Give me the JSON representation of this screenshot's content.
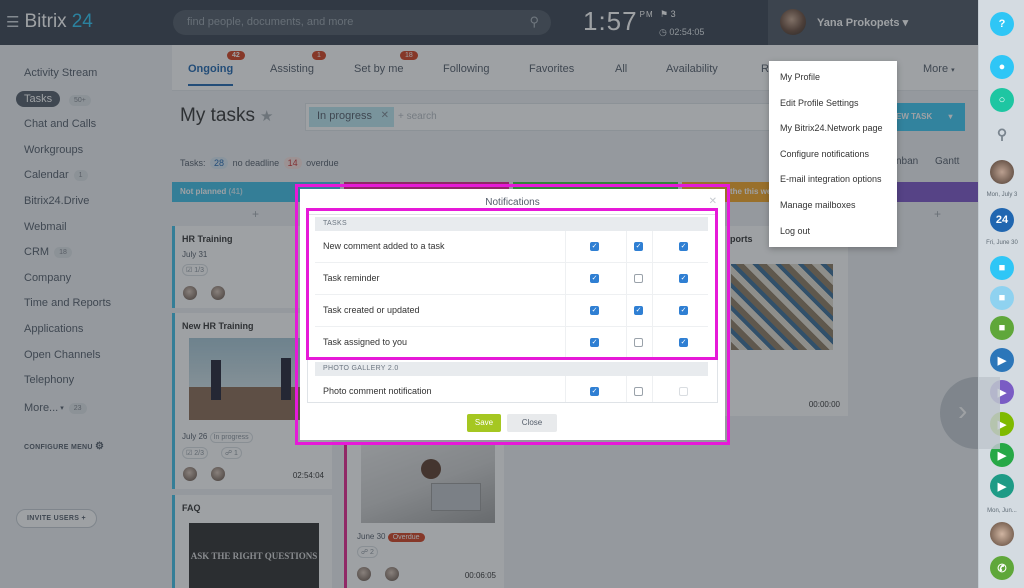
{
  "header": {
    "app_name": "Bitrix",
    "app_suffix": "24",
    "search_placeholder": "find people, documents, and more",
    "clock": "1:57",
    "clock_ampm": "PM",
    "flag_count": "3",
    "timer": "02:54:05",
    "user_name": "Yana Prokopets"
  },
  "left_nav": {
    "items": [
      {
        "label": "Activity Stream",
        "badge": ""
      },
      {
        "label": "Tasks",
        "badge": "50+"
      },
      {
        "label": "Chat and Calls",
        "badge": ""
      },
      {
        "label": "Workgroups",
        "badge": ""
      },
      {
        "label": "Calendar",
        "badge": "1"
      },
      {
        "label": "Bitrix24.Drive",
        "badge": ""
      },
      {
        "label": "Webmail",
        "badge": ""
      },
      {
        "label": "CRM",
        "badge": "18"
      },
      {
        "label": "Company",
        "badge": ""
      },
      {
        "label": "Time and Reports",
        "badge": ""
      },
      {
        "label": "Applications",
        "badge": ""
      },
      {
        "label": "Open Channels",
        "badge": ""
      },
      {
        "label": "Telephony",
        "badge": ""
      },
      {
        "label": "More...",
        "badge": "23"
      }
    ],
    "configure_menu": "CONFIGURE MENU",
    "invite_users": "INVITE USERS"
  },
  "tabs": [
    {
      "label": "Ongoing",
      "badge": "42"
    },
    {
      "label": "Assisting",
      "badge": "1"
    },
    {
      "label": "Set by me",
      "badge": "18"
    },
    {
      "label": "Following",
      "badge": ""
    },
    {
      "label": "Favorites",
      "badge": ""
    },
    {
      "label": "All",
      "badge": ""
    },
    {
      "label": "Availability",
      "badge": ""
    },
    {
      "label": "R",
      "badge": ""
    },
    {
      "label": "More",
      "badge": ""
    }
  ],
  "page": {
    "title": "My tasks",
    "filter_chip": "In progress",
    "filter_placeholder": "+ search",
    "new_task_label": "EW TASK",
    "counters_label": "Tasks:",
    "no_deadline_count": "28",
    "no_deadline_label": "no deadline",
    "overdue_count": "14",
    "overdue_label": "overdue",
    "view_kanban": "nban",
    "view_gantt": "Gantt"
  },
  "kanban": {
    "col1_title": "Not planned",
    "col1_count": "(41)",
    "col4_title": "the this we",
    "cards": [
      {
        "title": "HR Training",
        "date": "July 31",
        "pill": "1/3",
        "time": "0"
      },
      {
        "title": "New HR Training",
        "date": "July 26",
        "status": "In progress",
        "pill": "2/3",
        "pill2": "1",
        "time": "02:54:04"
      },
      {
        "title": "FAQ",
        "image_text": "ASK THE RIGHT QUESTIONS"
      },
      {
        "date": "June 30",
        "status": "Overdue",
        "pill": "2",
        "time": "00:06:05"
      },
      {
        "title": "ports",
        "time": "00:00:00"
      }
    ]
  },
  "dropdown": {
    "items": [
      "My Profile",
      "Edit Profile Settings",
      "My Bitrix24.Network page",
      "Configure notifications",
      "E-mail integration options",
      "Manage mailboxes",
      "Log out"
    ]
  },
  "modal": {
    "title": "Notifications",
    "sections": [
      {
        "name": "TASKS",
        "rows": [
          {
            "label": "New comment added to a task",
            "checks": [
              "on",
              "on",
              "on"
            ]
          },
          {
            "label": "Task reminder",
            "checks": [
              "on",
              "off",
              "on"
            ]
          },
          {
            "label": "Task created or updated",
            "checks": [
              "on",
              "on",
              "on"
            ]
          },
          {
            "label": "Task assigned to you",
            "checks": [
              "on",
              "off",
              "on"
            ]
          }
        ]
      },
      {
        "name": "PHOTO GALLERY 2.0",
        "rows": [
          {
            "label": "Photo comment notification",
            "checks": [
              "on",
              "off",
              "dis"
            ]
          }
        ]
      }
    ],
    "save_label": "Save",
    "close_label": "Close"
  },
  "right_rail": {
    "labels": [
      "Mon, July 3",
      "Fri, June 30",
      "Mon, Jun..."
    ],
    "day_number": "24"
  },
  "colors": {
    "topbar": "#3a4350",
    "highlight": "#e619d8",
    "checkbox_on": "#2f7fd3",
    "save_button": "#a5c721",
    "accent": "#2fc6f6"
  }
}
